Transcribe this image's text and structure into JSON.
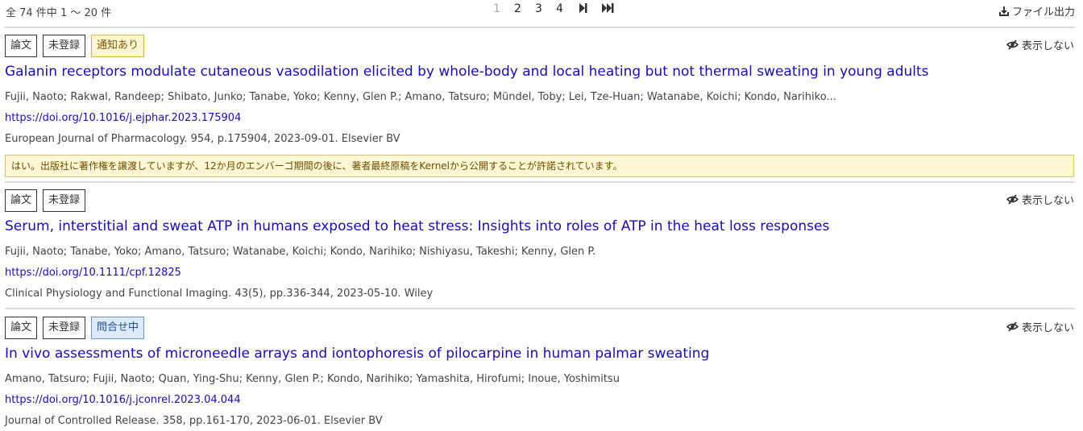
{
  "result_count": "全 74 件中 1 〜 20 件",
  "pagination": {
    "pages": [
      "1",
      "2",
      "3",
      "4"
    ],
    "current": "1",
    "next_icon": "next-page-icon",
    "last_icon": "last-page-icon"
  },
  "export": {
    "label": "ファイル出力",
    "icon": "download-icon"
  },
  "hide_label": "表示しない",
  "entries": [
    {
      "tags": [
        "論文",
        "未登録",
        "通知あり"
      ],
      "title": "Galanin receptors modulate cutaneous vasodilation elicited by whole-body and local heating but not thermal sweating in young adults",
      "authors": "Fujii, Naoto; Rakwal, Randeep; Shibato, Junko; Tanabe, Yoko; Kenny, Glen P.; Amano, Tatsuro; Mündel, Toby; Lei, Tze-Huan; Watanabe, Koichi; Kondo, Narihiko...",
      "doi": "https://doi.org/10.1016/j.ejphar.2023.175904",
      "source": "European Journal of Pharmacology. 954, p.175904, 2023-09-01. Elsevier BV",
      "notice": "はい。出版社に著作権を譲渡していますが、12か月のエンバーゴ期間の後に、著者最終原稿をKernelから公開することが許諾されています。"
    },
    {
      "tags": [
        "論文",
        "未登録"
      ],
      "title": "Serum, interstitial and sweat ATP in humans exposed to heat stress: Insights into roles of ATP in the heat loss responses",
      "authors": "Fujii, Naoto; Tanabe, Yoko; Amano, Tatsuro; Watanabe, Koichi; Kondo, Narihiko; Nishiyasu, Takeshi; Kenny, Glen P.",
      "doi": "https://doi.org/10.1111/cpf.12825",
      "source": "Clinical Physiology and Functional Imaging. 43(5), pp.336-344, 2023-05-10. Wiley"
    },
    {
      "tags": [
        "論文",
        "未登録",
        "問合せ中"
      ],
      "title": "In vivo assessments of microneedle arrays and iontophoresis of pilocarpine in human palmar sweating",
      "authors": "Amano, Tatsuro; Fujii, Naoto; Quan, Ying-Shu; Kenny, Glen P.; Kondo, Narihiko; Yamashita, Hirofumi; Inoue, Yoshimitsu",
      "doi": "https://doi.org/10.1016/j.jconrel.2023.04.044",
      "source": "Journal of Controlled Release. 358, pp.161-170, 2023-06-01. Elsevier BV"
    }
  ]
}
